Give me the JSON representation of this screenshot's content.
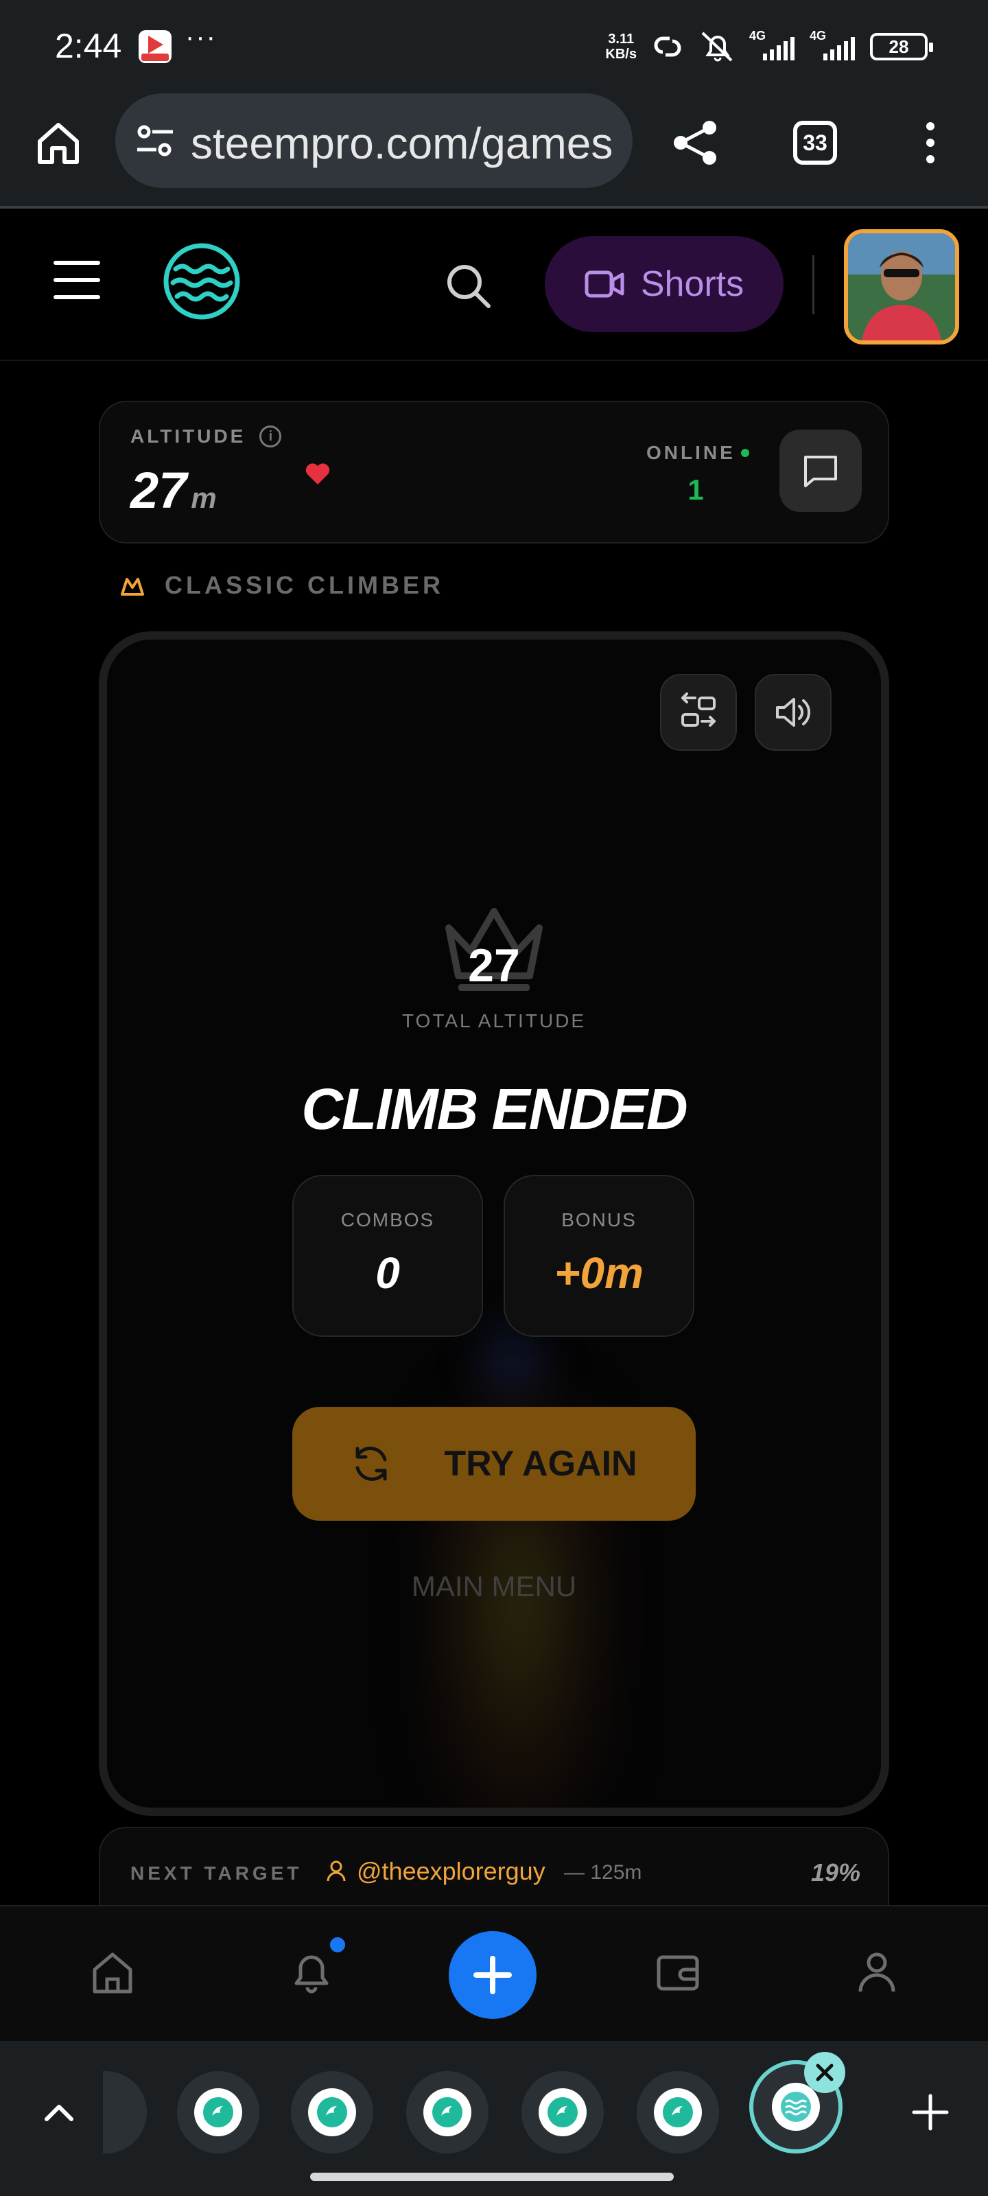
{
  "status_bar": {
    "time": "2:44",
    "more": "···",
    "net_speed_value": "3.11",
    "net_speed_unit": "KB/s",
    "sim1": "4G",
    "sim2": "4G",
    "battery": "28"
  },
  "browser": {
    "url": "steempro.com/games",
    "tab_count": "33",
    "icons": [
      "home-icon",
      "site-settings-icon",
      "share-icon",
      "tabs-icon",
      "more-vert-icon"
    ]
  },
  "header": {
    "shorts_label": "Shorts",
    "icons": [
      "menu-icon",
      "steempro-logo",
      "search-icon",
      "video-icon",
      "avatar"
    ]
  },
  "altitude_card": {
    "label": "ALTITUDE",
    "value": "27",
    "unit": "m",
    "online_label": "ONLINE",
    "online_count": "1"
  },
  "mode": {
    "label": "CLASSIC CLIMBER"
  },
  "game": {
    "score": "27",
    "score_label": "TOTAL ALTITUDE",
    "title": "CLIMB ENDED",
    "stats": [
      {
        "label": "COMBOS",
        "value": "0"
      },
      {
        "label": "BONUS",
        "value": "+0m"
      }
    ],
    "try_again_label": "TRY AGAIN",
    "main_menu_label": "MAIN MENU"
  },
  "next_target": {
    "label": "NEXT TARGET",
    "user": "@theexplorerguy",
    "distance": "— 125m",
    "percent": "19%"
  },
  "bottom_nav": {
    "items": [
      "home-icon",
      "bell-icon",
      "plus-icon",
      "wallet-icon",
      "user-icon"
    ]
  },
  "colors": {
    "accent_orange": "#f2a43a",
    "online_green": "#1db954",
    "primary_blue": "#1877f2",
    "shorts_purple": "#b98fe8",
    "try_again_bg": "#7a500c",
    "teal": "#6ad2cf"
  }
}
